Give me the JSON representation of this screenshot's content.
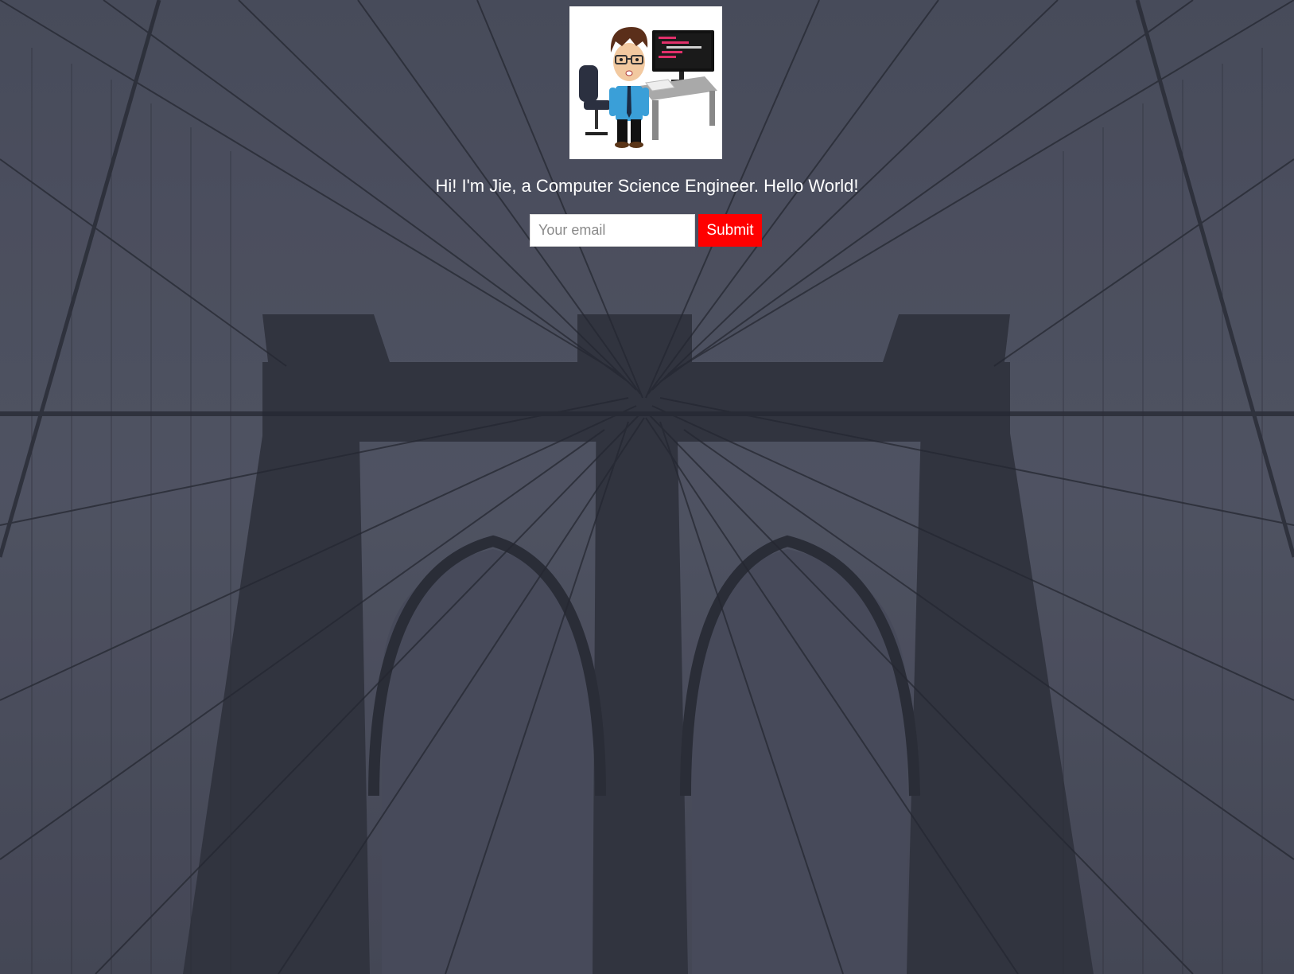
{
  "profile": {
    "avatar_icon": "programmer-avatar-icon",
    "greeting": "Hi! I'm Jie, a Computer Science Engineer. Hello World!"
  },
  "signup_form": {
    "email_placeholder": "Your email",
    "email_value": "",
    "submit_label": "Submit"
  },
  "colors": {
    "background_overlay": "#4a4d5c",
    "submit_button": "#ff0000",
    "text": "#ffffff"
  },
  "background": {
    "subject": "bridge-tower-photo"
  }
}
